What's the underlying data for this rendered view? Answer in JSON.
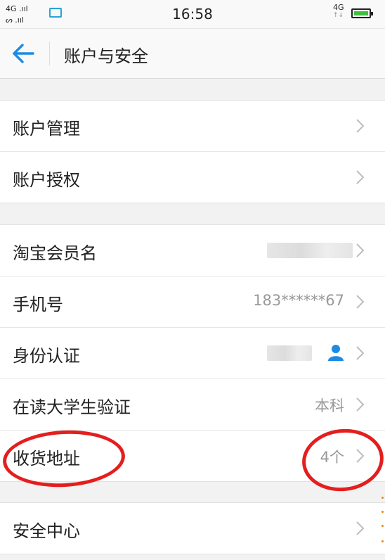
{
  "status_bar": {
    "network_top": "4G .ııl",
    "network_bottom": "ᔕ .ııl",
    "time": "16:58",
    "network_right": "4G"
  },
  "header": {
    "title": "账户与安全"
  },
  "groups": [
    {
      "items": [
        {
          "label": "账户管理",
          "value": ""
        },
        {
          "label": "账户授权",
          "value": ""
        }
      ]
    },
    {
      "items": [
        {
          "label": "淘宝会员名",
          "value": ""
        },
        {
          "label": "手机号",
          "value": "183******67"
        },
        {
          "label": "身份认证",
          "value": ""
        },
        {
          "label": "在读大学生验证",
          "value": "本科"
        },
        {
          "label": "收货地址",
          "value": "4个"
        }
      ]
    },
    {
      "items": [
        {
          "label": "安全中心",
          "value": ""
        }
      ]
    }
  ],
  "colors": {
    "accent": "#1e8be3",
    "annotation": "#e41e1e",
    "battery": "#3fbf3f"
  },
  "icons": {
    "back": "arrow-left-icon",
    "chevron": "chevron-right-icon",
    "identity": "person-icon"
  }
}
